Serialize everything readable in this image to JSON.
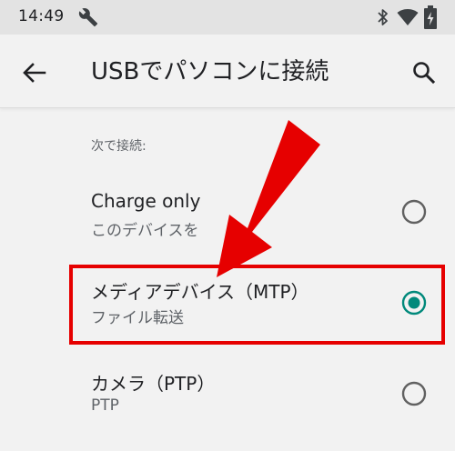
{
  "status_bar": {
    "time": "14:49",
    "icons": [
      "wrench-icon",
      "bluetooth-icon",
      "wifi-icon",
      "battery-icon"
    ]
  },
  "app_bar": {
    "title": "USBでパソコンに接続",
    "back_icon": "arrow-back-icon",
    "search_icon": "search-icon"
  },
  "section": {
    "header": "次で接続:"
  },
  "options": [
    {
      "title": "Charge only",
      "subtitle": "このデバイスを",
      "selected": false
    },
    {
      "title": "メディアデバイス（MTP）",
      "subtitle": "ファイル転送",
      "selected": true
    },
    {
      "title": "カメラ（PTP）",
      "subtitle": "PTP",
      "selected": false
    }
  ],
  "colors": {
    "accent": "#00897b",
    "radio_unselected": "#616161",
    "annotation": "#e60000",
    "background": "#f2f2f2",
    "status_bar": "#e3e3e3"
  }
}
